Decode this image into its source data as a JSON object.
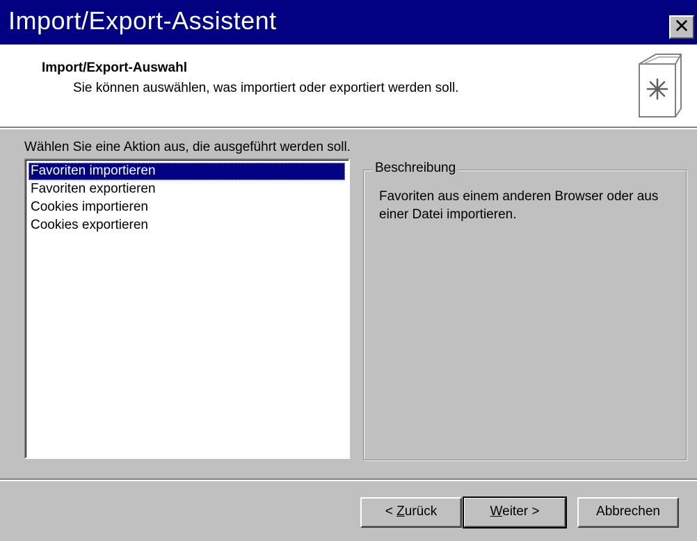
{
  "window": {
    "title": "Import/Export-Assistent",
    "close_glyph": "✕"
  },
  "header": {
    "heading": "Import/Export-Auswahl",
    "subheading": "Sie können auswählen, was importiert oder exportiert werden soll.",
    "icon": "wizard-book-icon"
  },
  "prompt": "Wählen Sie eine Aktion aus, die ausgeführt werden soll.",
  "actions": [
    {
      "label": "Favoriten importieren",
      "selected": true
    },
    {
      "label": "Favoriten exportieren",
      "selected": false
    },
    {
      "label": "Cookies importieren",
      "selected": false
    },
    {
      "label": "Cookies exportieren",
      "selected": false
    }
  ],
  "description": {
    "legend": "Beschreibung",
    "text": "Favoriten aus einem anderen Browser oder aus einer Datei importieren."
  },
  "buttons": {
    "back": {
      "prefix": "< ",
      "mnemonic": "Z",
      "rest": "urück"
    },
    "next": {
      "mnemonic": "W",
      "rest": "eiter >"
    },
    "cancel": "Abbrechen"
  },
  "colors": {
    "titlebar": "#000080",
    "face": "#c0c0c0",
    "selection": "#000080"
  }
}
